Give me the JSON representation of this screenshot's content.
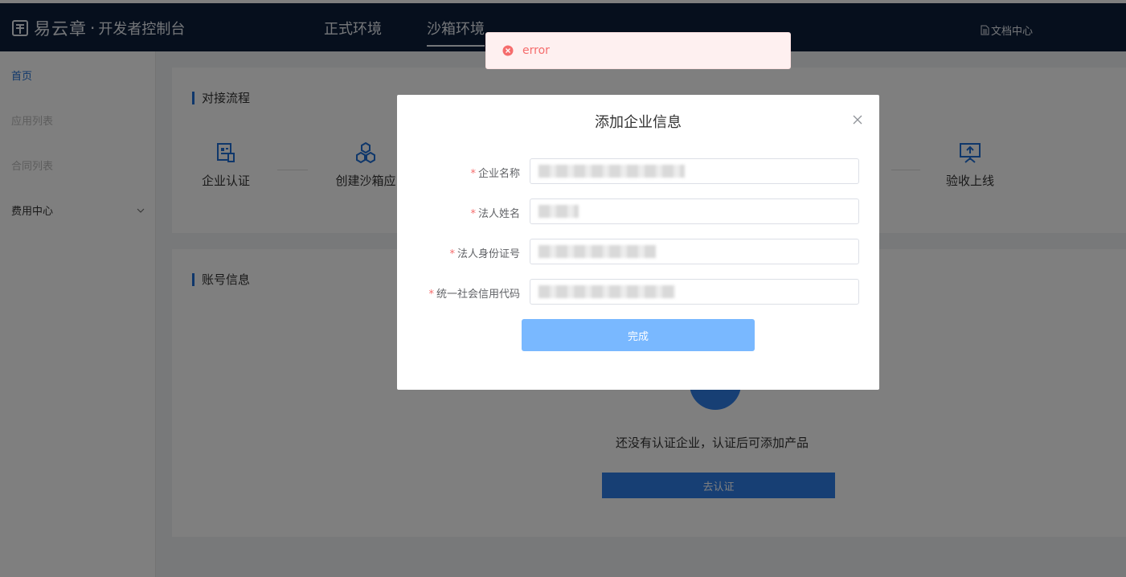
{
  "header": {
    "brand_name": "易云章",
    "brand_sep": "·",
    "brand_sub": "开发者控制台",
    "env_tabs": [
      {
        "label": "正式环境",
        "active": false
      },
      {
        "label": "沙箱环境",
        "active": true
      }
    ],
    "doc_link": "文档中心"
  },
  "sidebar": {
    "items": [
      {
        "label": "首页",
        "state": "active"
      },
      {
        "label": "应用列表",
        "state": "muted"
      },
      {
        "label": "合同列表",
        "state": "muted"
      },
      {
        "label": "费用中心",
        "state": "normal",
        "icon": "chevron-down-icon"
      }
    ]
  },
  "flow": {
    "title": "对接流程",
    "steps": [
      {
        "label": "企业认证",
        "icon": "enterprise-cert-icon"
      },
      {
        "label": "创建沙箱应",
        "icon": "create-sandbox-icon"
      },
      {
        "label": "验收上线",
        "icon": "acceptance-online-icon"
      }
    ]
  },
  "account": {
    "title": "账号信息",
    "empty_text": "还没有认证企业，认证后可添加产品",
    "certify_label": "去认证"
  },
  "modal": {
    "title": "添加企业信息",
    "fields": [
      {
        "required": "*",
        "label": "企业名称",
        "value": ""
      },
      {
        "required": "*",
        "label": "法人姓名",
        "value": ""
      },
      {
        "required": "*",
        "label": "法人身份证号",
        "value": ""
      },
      {
        "required": "*",
        "label": "统一社会信用代码",
        "value": ""
      }
    ],
    "submit_label": "完成"
  },
  "toast": {
    "type": "error",
    "message": "error"
  },
  "colors": {
    "header_bg": "#0c1f3b",
    "accent": "#1f6fd6",
    "submit_disabled": "#79b8ff",
    "error": "#f56c6c",
    "error_bg": "#fef0f0"
  }
}
